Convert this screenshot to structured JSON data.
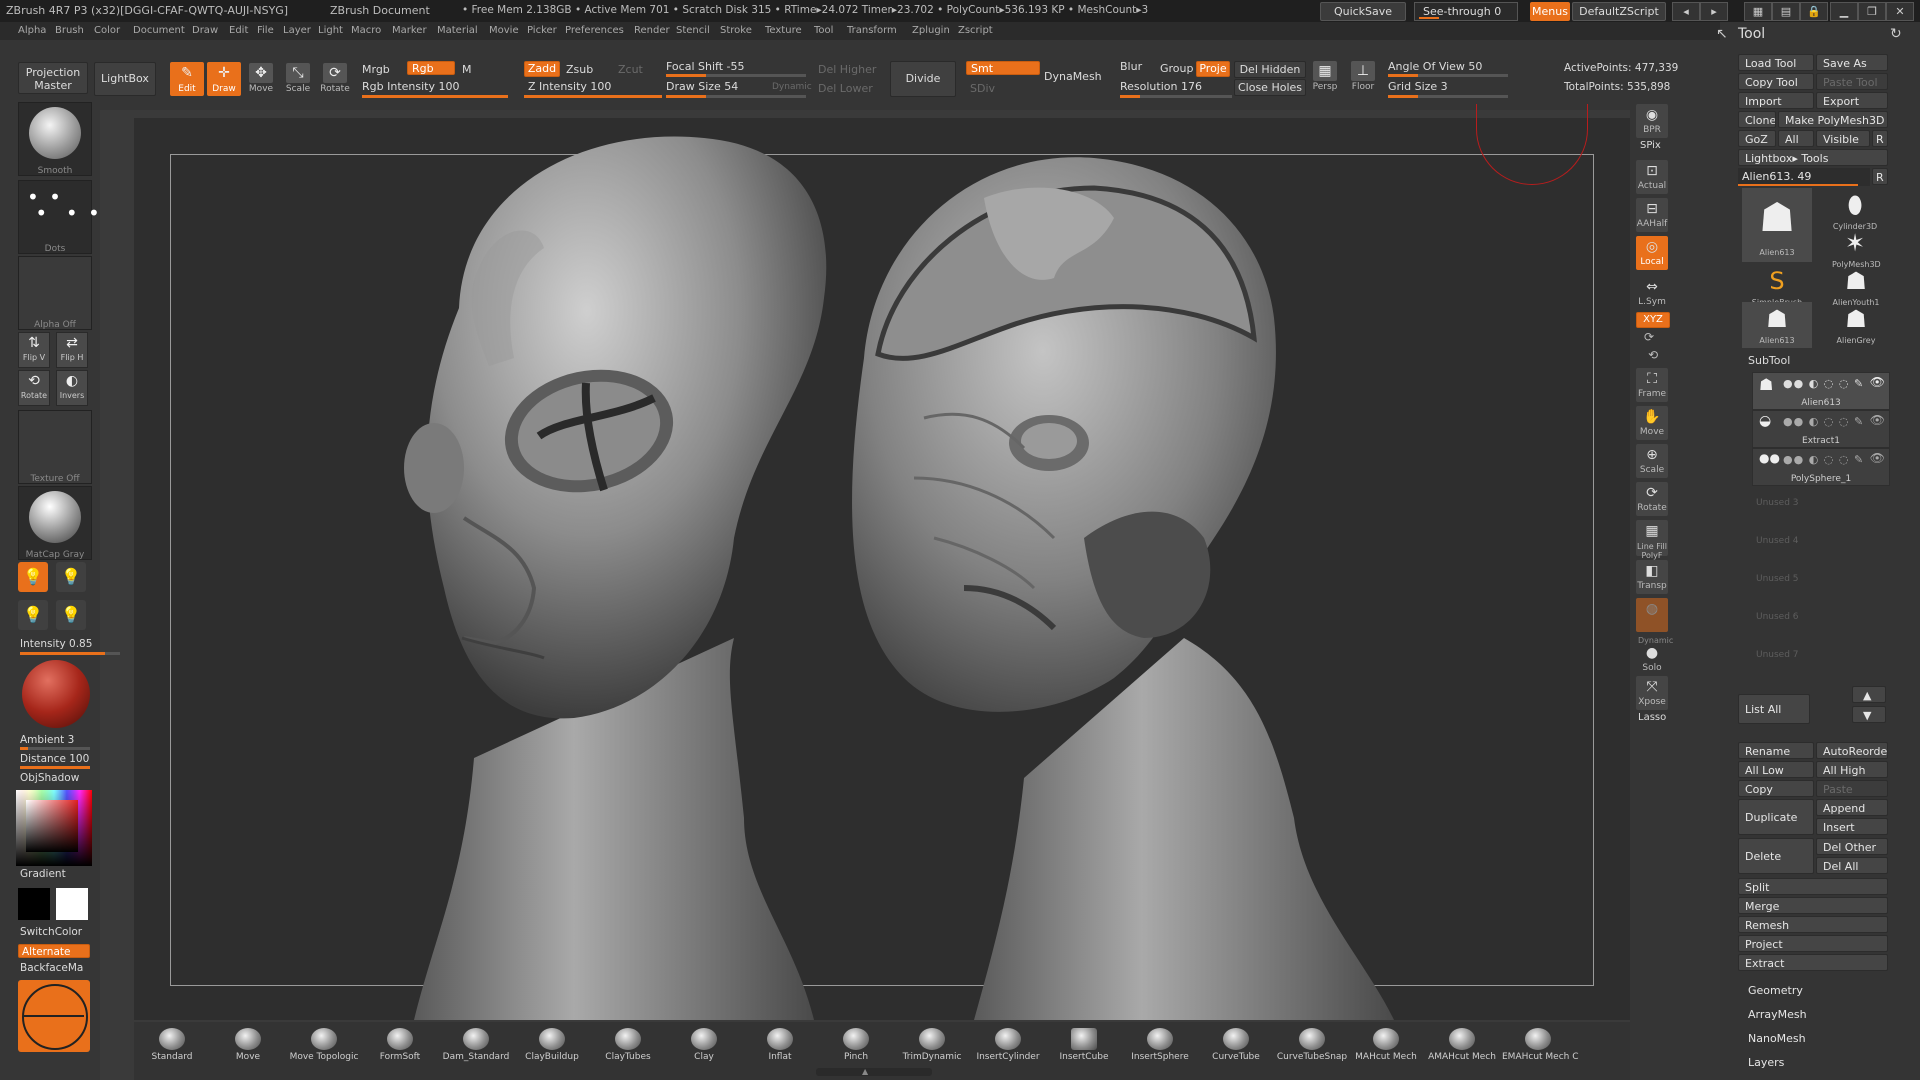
{
  "titlebar": {
    "app": "ZBrush 4R7 P3 (x32)[DGGI-CFAF-QWTQ-AUJI-NSYG]",
    "doc": "ZBrush Document",
    "stats": "• Free Mem 2.138GB • Active Mem 701 • Scratch Disk 315 • RTime▸24.072 Timer▸23.702 • PolyCount▸536.193 KP • MeshCount▸3",
    "quicksave": "QuickSave",
    "seethrough": "See-through 0",
    "seethrough_value": 0,
    "menus": "Menus",
    "script": "DefaultZScript"
  },
  "menus": [
    "Alpha",
    "Brush",
    "Color",
    "Document",
    "Draw",
    "Edit",
    "File",
    "Layer",
    "Light",
    "Macro",
    "Marker",
    "Material",
    "Movie",
    "Picker",
    "Preferences",
    "Render",
    "Stencil",
    "Stroke",
    "Texture",
    "Tool",
    "Transform",
    "Zplugin",
    "Zscript"
  ],
  "toolbar": {
    "projection_master": "Projection Master",
    "lightbox": "LightBox",
    "edit": "Edit",
    "draw": "Draw",
    "move": "Move",
    "scale": "Scale",
    "rotate": "Rotate",
    "mrgb": "Mrgb",
    "rgb": "Rgb",
    "m": "M",
    "rgb_intensity": "Rgb Intensity 100",
    "zadd": "Zadd",
    "zsub": "Zsub",
    "zcut": "Zcut",
    "z_intensity": "Z Intensity 100",
    "focal_shift": "Focal Shift -55",
    "draw_size": "Draw Size 54",
    "dynamic": "Dynamic",
    "del_higher": "Del Higher",
    "del_lower": "Del Lower",
    "divide": "Divide",
    "smt": "Smt",
    "sdiv": "SDiv",
    "dynamesh": "DynaMesh",
    "blur": "Blur",
    "group": "Group",
    "proje": "Proje",
    "del_hidden": "Del Hidden",
    "close_holes": "Close Holes",
    "resolution": "Resolution 176",
    "persp": "Persp",
    "floor": "Floor",
    "angle_of_view": "Angle Of View 50",
    "grid_size": "Grid Size 3",
    "active_points": "ActivePoints: 477,339",
    "total_points": "TotalPoints: 535,898"
  },
  "leftshelf": {
    "smooth": "Smooth",
    "dots": "Dots",
    "alpha_off": "Alpha Off",
    "flipv": "Flip V",
    "fliph": "Flip H",
    "rotate": "Rotate",
    "invers": "Invers",
    "texture_off": "Texture Off",
    "matcap_gray": "MatCap Gray",
    "intensity": "Intensity 0.85",
    "ambient": "Ambient 3",
    "distance": "Distance 100",
    "objshadow": "ObjShadow",
    "gradient": "Gradient",
    "switchcolor": "SwitchColor",
    "alternate": "Alternate",
    "backface": "BackfaceMa"
  },
  "rightshelf": [
    "BPR",
    "SPix",
    "Actual",
    "AAHalf",
    "Local",
    "L.Sym",
    "XYZ",
    "Frame",
    "Move",
    "Scale",
    "Rotate",
    "Line Fill PolyF",
    "Transp",
    "Dynamic",
    "Solo",
    "Xpose",
    "Lasso"
  ],
  "palette": {
    "title": "Tool",
    "load_tool": "Load Tool",
    "save_as": "Save As",
    "copy_tool": "Copy Tool",
    "paste_tool": "Paste Tool",
    "import": "Import",
    "export": "Export",
    "clone": "Clone",
    "make_polymesh": "Make PolyMesh3D",
    "goz": "GoZ",
    "all": "All",
    "visible": "Visible",
    "r": "R",
    "lightbox_tools": "Lightbox▸ Tools",
    "current_tool": "Alien613. 49",
    "thumbs": [
      {
        "label": "Alien613",
        "icon": "alien-head-icon"
      },
      {
        "label": "Cylinder3D",
        "icon": "cylinder-icon"
      },
      {
        "label": "PolyMesh3D",
        "icon": "star-icon"
      },
      {
        "label": "SimpleBrush",
        "icon": "s-brush-icon"
      },
      {
        "label": "AlienYouth1",
        "icon": "alien-icon"
      },
      {
        "label": "Alien613",
        "icon": "alien-icon"
      },
      {
        "label": "AlienGrey",
        "icon": "alien-icon"
      }
    ],
    "subtool_header": "SubTool",
    "subtools": [
      "Alien613",
      "Extract1",
      "PolySphere_1"
    ],
    "unused": [
      "Unused 3",
      "Unused 4",
      "Unused 5",
      "Unused 6",
      "Unused 7"
    ],
    "list_all": "List All",
    "rename": "Rename",
    "autoreorder": "AutoReorder",
    "all_low": "All Low",
    "all_high": "All High",
    "copy": "Copy",
    "paste": "Paste",
    "duplicate": "Duplicate",
    "append": "Append",
    "insert": "Insert",
    "delete": "Delete",
    "del_other": "Del Other",
    "del_all": "Del All",
    "split": "Split",
    "merge": "Merge",
    "remesh": "Remesh",
    "project": "Project",
    "extract": "Extract",
    "geometry": "Geometry",
    "arraymesh": "ArrayMesh",
    "nanomesh": "NanoMesh",
    "layers": "Layers"
  },
  "brushes": [
    "Standard",
    "Move",
    "Move Topologic",
    "FormSoft",
    "Dam_Standard",
    "ClayBuildup",
    "ClayTubes",
    "Clay",
    "Inflat",
    "Pinch",
    "TrimDynamic",
    "InsertCylinder",
    "InsertCube",
    "InsertSphere",
    "CurveTube",
    "CurveTubeSnap",
    "MAHcut Mech",
    "AMAHcut Mech",
    "EMAHcut Mech C"
  ],
  "colors": {
    "accent": "#e9701b",
    "bg": "#3a3a3a",
    "canvas": "#2e2e2e"
  }
}
